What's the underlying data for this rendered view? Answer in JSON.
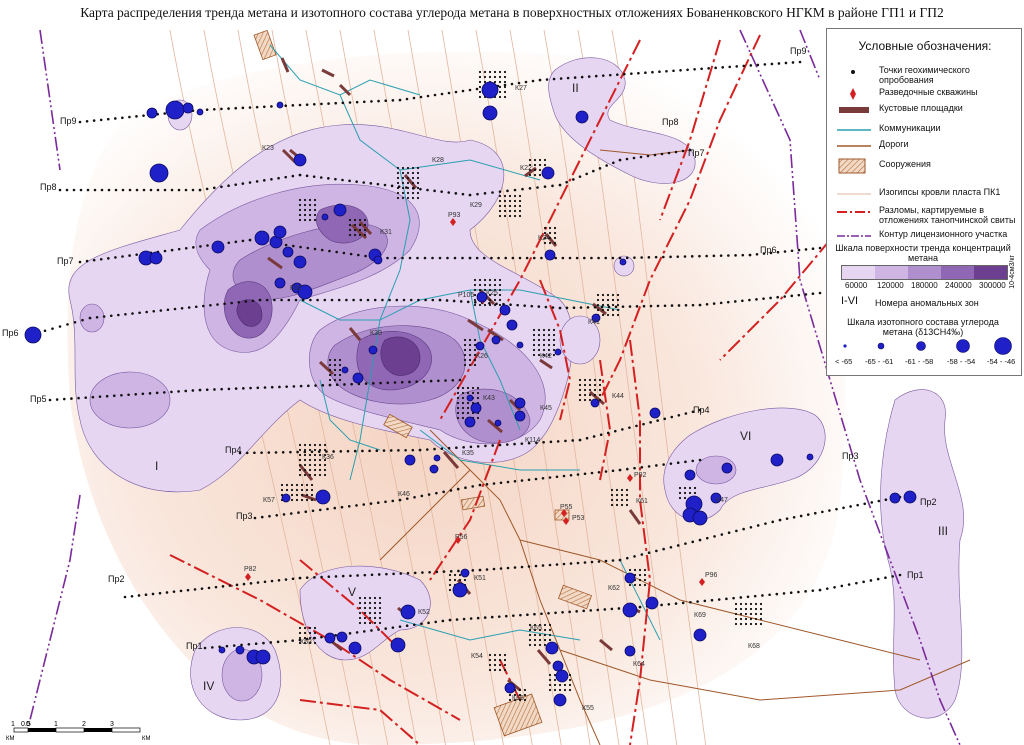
{
  "title": "Карта распределения тренда метана и изотопного состава углерода метана в поверхностных отложениях Бованенковского НГКМ в районе ГП1 и ГП2",
  "legend": {
    "title": "Условные обозначения:",
    "items": [
      {
        "icon": "sampling-point-icon",
        "label": "Точки геохимического опробования"
      },
      {
        "icon": "exploration-well-icon",
        "label": "Разведочные скважины"
      },
      {
        "icon": "cluster-pad-icon",
        "label": "Кустовые площадки"
      },
      {
        "icon": "communications-icon",
        "label": "Коммуникации"
      },
      {
        "icon": "roads-icon",
        "label": "Дороги"
      },
      {
        "icon": "structures-icon",
        "label": "Сооружения"
      },
      {
        "icon": "isohypse-icon",
        "label": "Изогипсы кровли пласта ПК1"
      },
      {
        "icon": "fault-icon",
        "label": "Разломы, картируемые в отложениях танопчинской свиты"
      },
      {
        "icon": "license-boundary-icon",
        "label": "Контур лицензионного участка"
      }
    ],
    "trend_scale_title": "Шкала поверхности тренда концентраций метана",
    "trend_scale_unit": "10-4см3/кг",
    "trend_scale_ticks": [
      "60000",
      "120000",
      "180000",
      "240000",
      "300000"
    ],
    "trend_colors": [
      "#e6d6f2",
      "#cfb5e4",
      "#b08fcf",
      "#8f67b5",
      "#6c3f90"
    ],
    "zones_symbol": "I-VI",
    "zones_label": "Номера аномальных зон",
    "isotope_scale_title": "Шкала изотопного состава углерода метана (δ13CH4‰)",
    "isotope_classes": [
      "< -65",
      "-65 - -61",
      "-61 - -58",
      "-58 - -54",
      "-54 - -46"
    ]
  },
  "profiles": [
    "Пр9",
    "Пр8",
    "Пр7",
    "Пр6",
    "Пр5",
    "Пр4",
    "Пр3",
    "Пр2",
    "Пр1"
  ],
  "zones": [
    "I",
    "II",
    "III",
    "IV",
    "V",
    "VI"
  ],
  "clusters": [
    "К27",
    "К23",
    "К28",
    "К22",
    "К29",
    "К31",
    "К24",
    "К32",
    "К25",
    "К41",
    "К30",
    "К42",
    "К44",
    "К26",
    "К43",
    "К45",
    "К36",
    "К35",
    "К114",
    "К57",
    "К46",
    "К47",
    "К61",
    "К51",
    "К52",
    "К53",
    "К62",
    "К69",
    "К65",
    "К54",
    "К64",
    "К68",
    "К66",
    "К55"
  ],
  "wells": [
    "Р93",
    "Р105",
    "Р92",
    "Р55",
    "Р53",
    "Р56",
    "Р82",
    "Р96"
  ],
  "scale_bar": {
    "labels": [
      "1",
      "0.5",
      "0",
      "1",
      "2",
      "3"
    ],
    "unit": "КМ"
  },
  "colors": {
    "fault": "#d42020",
    "license": "#7a2a9a",
    "communications": "#2a9fb0",
    "roads": "#a0582a",
    "sample_point": "#111111",
    "anomaly_circle": "#2020c8",
    "pad": "#7a3a3a"
  }
}
